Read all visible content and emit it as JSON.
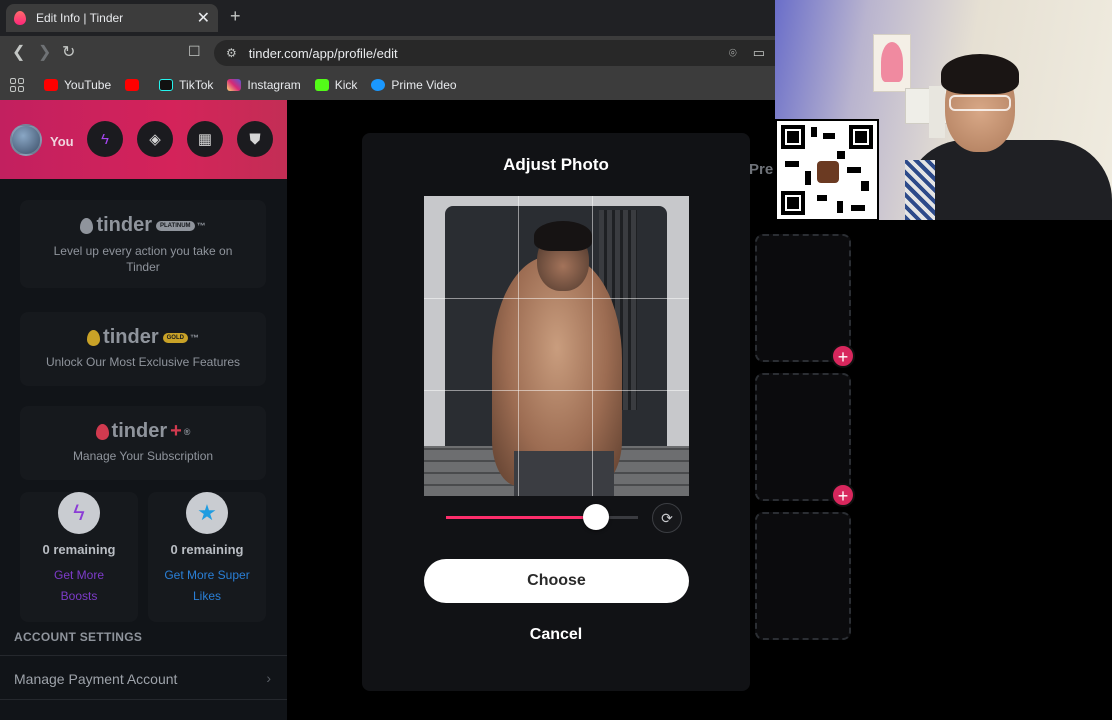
{
  "browser": {
    "tab_title": "Edit Info | Tinder",
    "tab_close": "✕",
    "new_tab": "+",
    "url": "tinder.com/app/profile/edit",
    "bookmarks": [
      {
        "label": "YouTube",
        "color": "#ff0000"
      },
      {
        "label": "",
        "color": "#ff0000"
      },
      {
        "label": "TikTok",
        "color": "#111111"
      },
      {
        "label": "Instagram",
        "color": "#d6249f"
      },
      {
        "label": "Kick",
        "color": "#53fc18"
      },
      {
        "label": "Prime Video",
        "color": "#1a98ff"
      }
    ]
  },
  "sidebar": {
    "you_label": "You",
    "header_icons": [
      "boost-icon",
      "explore-icon",
      "briefcase-icon",
      "shield-icon"
    ],
    "cards": [
      {
        "brand": "tinder",
        "badge": "PLATINUM",
        "mark": "™",
        "text": "Level up every action you take on Tinder"
      },
      {
        "brand": "tinder",
        "badge": "GOLD",
        "mark": "™",
        "text": "Unlock Our Most Exclusive Features"
      },
      {
        "brand": "tinder",
        "badge": "+",
        "mark": "®",
        "text": "Manage Your Subscription"
      }
    ],
    "boosts": {
      "remaining": "0 remaining",
      "link1": "Get More",
      "link2": "Boosts"
    },
    "super_likes": {
      "remaining": "0 remaining",
      "link1": "Get More Super",
      "link2": "Likes"
    },
    "account_settings": "ACCOUNT SETTINGS",
    "manage_payment": "Manage Payment Account"
  },
  "main": {
    "preview_partial": "Pre"
  },
  "modal": {
    "title": "Adjust Photo",
    "zoom_level": 0.78,
    "choose_label": "Choose",
    "cancel_label": "Cancel"
  },
  "colors": {
    "brand_pink": "#fd2e6b",
    "header_gradient_start": "#c2205f",
    "gold": "#c9a227",
    "platinum_badge": "#8f949c"
  }
}
